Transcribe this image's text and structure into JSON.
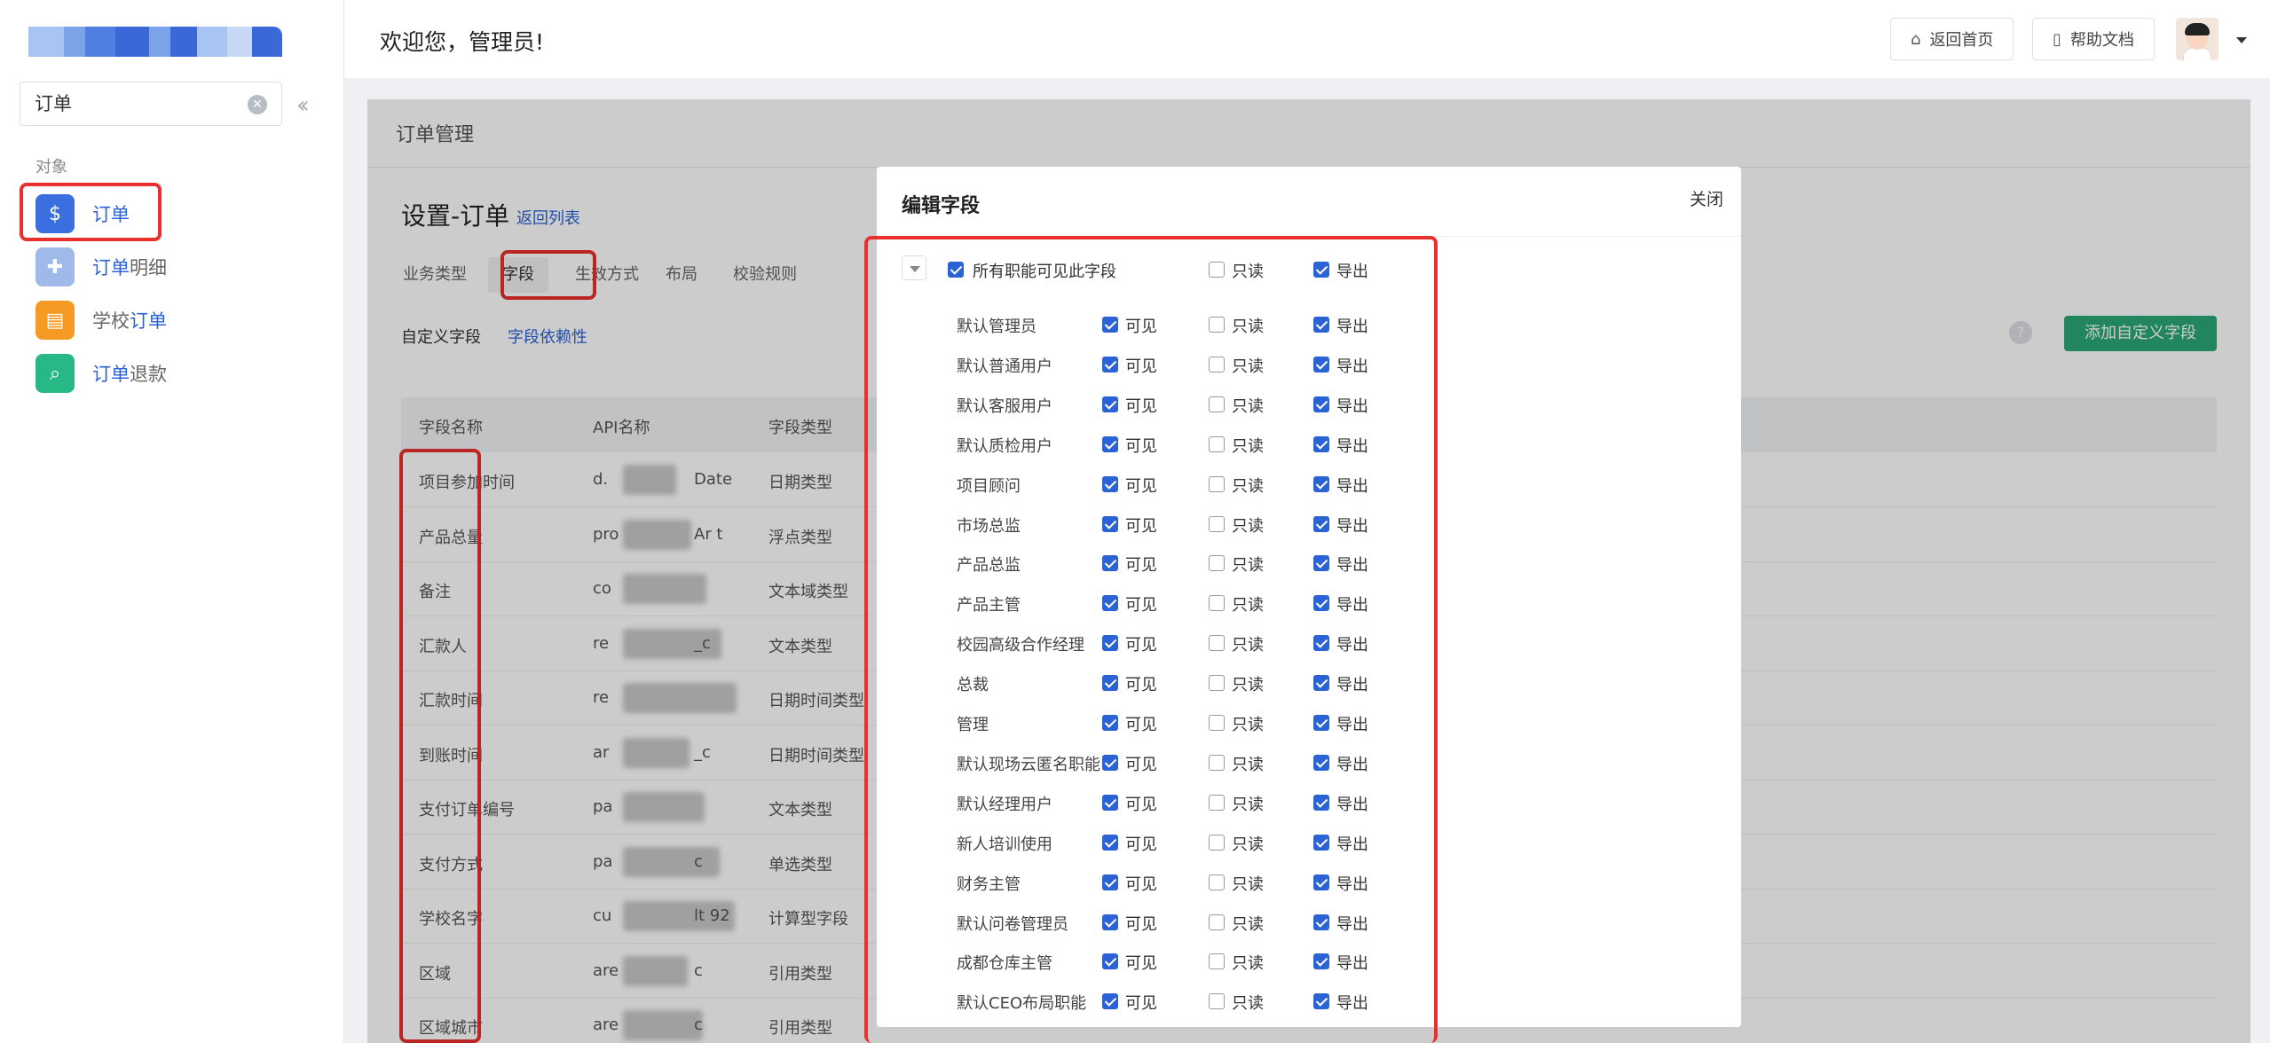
{
  "header": {
    "welcome": "欢迎您，管理员!",
    "home_button": "返回首页",
    "docs_button": "帮助文档"
  },
  "sidebar": {
    "search_value": "订单",
    "section_title": "对象",
    "items": [
      {
        "prefix": "",
        "highlight": "订单",
        "suffix": "",
        "icon": "dollar-doc-icon",
        "color": "#3b6fe0"
      },
      {
        "prefix": "",
        "highlight": "订单",
        "suffix": "明细",
        "icon": "puzzle-icon",
        "color": "#9fb9e8"
      },
      {
        "prefix": "学校",
        "highlight": "订单",
        "suffix": "",
        "icon": "briefcase-icon",
        "color": "#f59a23"
      },
      {
        "prefix": "",
        "highlight": "订单",
        "suffix": "退款",
        "icon": "search-doc-icon",
        "color": "#26b985"
      }
    ]
  },
  "main": {
    "breadcrumb": "订单管理",
    "title": "设置-订单",
    "back_link": "返回列表",
    "tabs": [
      "业务类型",
      "字段",
      "生效方式",
      "布局",
      "校验规则"
    ],
    "subtabs": [
      "自定义字段",
      "字段依赖性"
    ],
    "add_button": "添加自定义字段",
    "help": "?",
    "table": {
      "headers": [
        "字段名称",
        "API名称",
        "字段类型"
      ],
      "rows": [
        {
          "name": "项目参加时间",
          "api": "d.",
          "api_tail": "Date",
          "type": "日期类型"
        },
        {
          "name": "产品总量",
          "api": "pro",
          "api_tail": "Ar    t",
          "type": "浮点类型"
        },
        {
          "name": "备注",
          "api": "co",
          "api_tail": "",
          "type": "文本域类型"
        },
        {
          "name": "汇款人",
          "api": "re",
          "api_tail": "_c",
          "type": "文本类型"
        },
        {
          "name": "汇款时间",
          "api": "re",
          "api_tail": "",
          "type": "日期时间类型"
        },
        {
          "name": "到账时间",
          "api": "ar",
          "api_tail": "_c",
          "type": "日期时间类型"
        },
        {
          "name": "支付订单编号",
          "api": "pa",
          "api_tail": "",
          "type": "文本类型"
        },
        {
          "name": "支付方式",
          "api": "pa",
          "api_tail": "c",
          "type": "单选类型"
        },
        {
          "name": "学校名字",
          "api": "cu",
          "api_tail": "lt    92",
          "type": "计算型字段"
        },
        {
          "name": "区域",
          "api": "are",
          "api_tail": "c",
          "type": "引用类型"
        },
        {
          "name": "区域城市",
          "api": "are",
          "api_tail": "c",
          "type": "引用类型"
        }
      ]
    }
  },
  "modal": {
    "title": "编辑字段",
    "close": "关闭",
    "all_row": {
      "label": "所有职能可见此字段",
      "visible": true,
      "readonly_label": "只读",
      "readonly": false,
      "export_label": "导出",
      "export": true
    },
    "labels": {
      "visible": "可见",
      "readonly": "只读",
      "export": "导出"
    },
    "roles": [
      {
        "name": "默认管理员",
        "visible": true,
        "readonly": false,
        "export": true
      },
      {
        "name": "默认普通用户",
        "visible": true,
        "readonly": false,
        "export": true
      },
      {
        "name": "默认客服用户",
        "visible": true,
        "readonly": false,
        "export": true
      },
      {
        "name": "默认质检用户",
        "visible": true,
        "readonly": false,
        "export": true
      },
      {
        "name": "项目顾问",
        "visible": true,
        "readonly": false,
        "export": true
      },
      {
        "name": "市场总监",
        "visible": true,
        "readonly": false,
        "export": true
      },
      {
        "name": "产品总监",
        "visible": true,
        "readonly": false,
        "export": true
      },
      {
        "name": "产品主管",
        "visible": true,
        "readonly": false,
        "export": true
      },
      {
        "name": "校园高级合作经理",
        "visible": true,
        "readonly": false,
        "export": true
      },
      {
        "name": "总裁",
        "visible": true,
        "readonly": false,
        "export": true
      },
      {
        "name": "管理",
        "visible": true,
        "readonly": false,
        "export": true
      },
      {
        "name": "默认现场云匿名职能",
        "visible": true,
        "readonly": false,
        "export": true
      },
      {
        "name": "默认经理用户",
        "visible": true,
        "readonly": false,
        "export": true
      },
      {
        "name": "新人培训使用",
        "visible": true,
        "readonly": false,
        "export": true
      },
      {
        "name": "财务主管",
        "visible": true,
        "readonly": false,
        "export": true
      },
      {
        "name": "默认问卷管理员",
        "visible": true,
        "readonly": false,
        "export": true
      },
      {
        "name": "成都仓库主管",
        "visible": true,
        "readonly": false,
        "export": true
      },
      {
        "name": "默认CEO布局职能",
        "visible": true,
        "readonly": false,
        "export": true
      }
    ]
  }
}
